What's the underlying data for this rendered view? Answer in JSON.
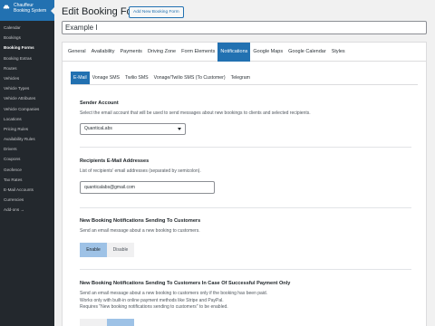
{
  "sidebar": {
    "brand_line1": "Chauffeur",
    "brand_line2": "Booking System",
    "items": [
      {
        "label": "Calendar"
      },
      {
        "label": "Bookings"
      },
      {
        "label": "Booking Forms"
      },
      {
        "label": "Booking Extras"
      },
      {
        "label": "Routes"
      },
      {
        "label": "Vehicles"
      },
      {
        "label": "Vehicle Types"
      },
      {
        "label": "Vehicle Attributes"
      },
      {
        "label": "Vehicle Companies"
      },
      {
        "label": "Locations"
      },
      {
        "label": "Pricing Rules"
      },
      {
        "label": "Availability Rules"
      },
      {
        "label": "Drivers"
      },
      {
        "label": "Coupons"
      },
      {
        "label": "Geofence"
      },
      {
        "label": "Tax Rates"
      },
      {
        "label": "E-Mail Accounts"
      },
      {
        "label": "Currencies"
      },
      {
        "label": "Add-ons →"
      }
    ]
  },
  "header": {
    "title": "Edit Booking Form",
    "add_new_label": "Add New Booking Form",
    "form_name_value": "Example I"
  },
  "tabs": [
    {
      "label": "General"
    },
    {
      "label": "Availability"
    },
    {
      "label": "Payments"
    },
    {
      "label": "Driving Zone"
    },
    {
      "label": "Form Elements"
    },
    {
      "label": "Notifications"
    },
    {
      "label": "Google Maps"
    },
    {
      "label": "Google Calendar"
    },
    {
      "label": "Styles"
    }
  ],
  "subtabs": [
    {
      "label": "E-Mail"
    },
    {
      "label": "Vonage SMS"
    },
    {
      "label": "Twilio SMS"
    },
    {
      "label": "Vonage/Twilio SMS (To Customer)"
    },
    {
      "label": "Telegram"
    }
  ],
  "sections": {
    "sender": {
      "title": "Sender Account",
      "desc": "Select the email account that will be used to send messages about new bookings to clients and selected recipients.",
      "selected": "QuanticaLabs"
    },
    "recipients": {
      "title": "Recipients E-Mail Addresses",
      "desc": "List of recipients' email addresses (separated by semicolon).",
      "value": "quanticalabs@gmail.com"
    },
    "customers": {
      "title": "New Booking Notifications Sending To Customers",
      "desc": "Send an email message about a new booking to customers.",
      "enable_label": "Enable",
      "disable_label": "Disable"
    },
    "paid": {
      "title": "New Booking Notifications Sending To Customers In Case Of Successful Payment Only",
      "desc1": "Send an email message about a new booking to customers only if the booking has been paid.",
      "desc2": "Works only with built-in online payment methods like Stripe and PayPal.",
      "desc3": "Requires \"New booking notifications sending to customers\" to be enabled."
    }
  },
  "colors": {
    "accent": "#2271b1",
    "sidebar_bg": "#23282d",
    "enable_active": "#9ec2e6"
  }
}
